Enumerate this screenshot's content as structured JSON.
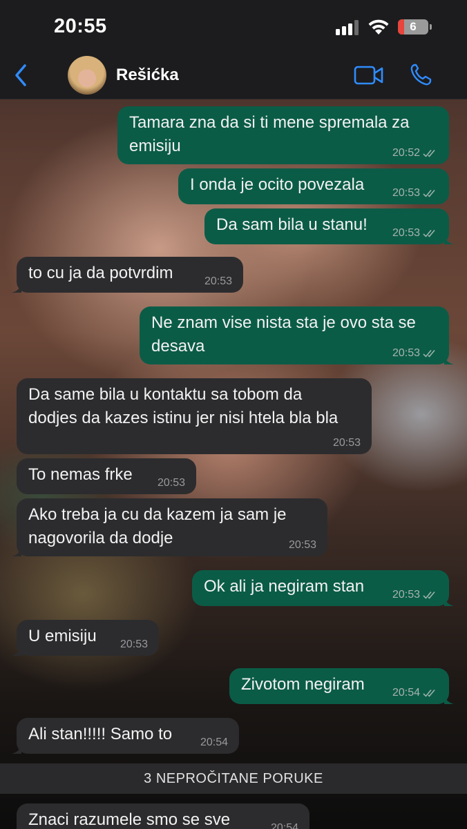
{
  "status_bar": {
    "time": "20:55",
    "battery_level": "6",
    "battery_fraction": 0.06
  },
  "header": {
    "contact_name": "Rešićka",
    "icons": [
      "back-chevron-icon",
      "video-call-icon",
      "phone-call-icon"
    ]
  },
  "colors": {
    "outgoing_bubble": "#0b5c47",
    "incoming_bubble": "#2c2c2e",
    "accent": "#2f8cff",
    "bar_background": "#1c1c1e"
  },
  "messages": [
    {
      "direction": "out",
      "text": "Tamara zna da si ti mene spremala za emisiju",
      "time": "20:52",
      "read": true
    },
    {
      "direction": "out",
      "text": "I onda je ocito povezala",
      "time": "20:53",
      "read": true
    },
    {
      "direction": "out",
      "text": "Da sam bila u stanu!",
      "time": "20:53",
      "read": true
    },
    {
      "direction": "in",
      "text": "to cu ja da potvrdim",
      "time": "20:53"
    },
    {
      "direction": "out",
      "text": "Ne znam vise nista sta je ovo sta se desava",
      "time": "20:53",
      "read": true
    },
    {
      "direction": "in",
      "text": "Da same bila u kontaktu sa tobom da dodjes da kazes istinu jer nisi htela bla bla",
      "time": "20:53"
    },
    {
      "direction": "in",
      "text": "To nemas frke",
      "time": "20:53"
    },
    {
      "direction": "in",
      "text": "Ako treba ja cu da kazem ja sam je nagovorila da dodje",
      "time": "20:53"
    },
    {
      "direction": "out",
      "text": "Ok ali ja negiram stan",
      "time": "20:53",
      "read": true
    },
    {
      "direction": "in",
      "text": "U emisiju",
      "time": "20:53"
    },
    {
      "direction": "out",
      "text": "Zivotom negiram",
      "time": "20:54",
      "read": true
    },
    {
      "direction": "in",
      "text": "Ali stan!!!!! Samo to",
      "time": "20:54"
    }
  ],
  "unread_banner": "3 NEPROČITANE PORUKE",
  "unread_messages": [
    {
      "direction": "in",
      "text": "Znaci razumele smo se sve",
      "time": "20:54"
    }
  ]
}
